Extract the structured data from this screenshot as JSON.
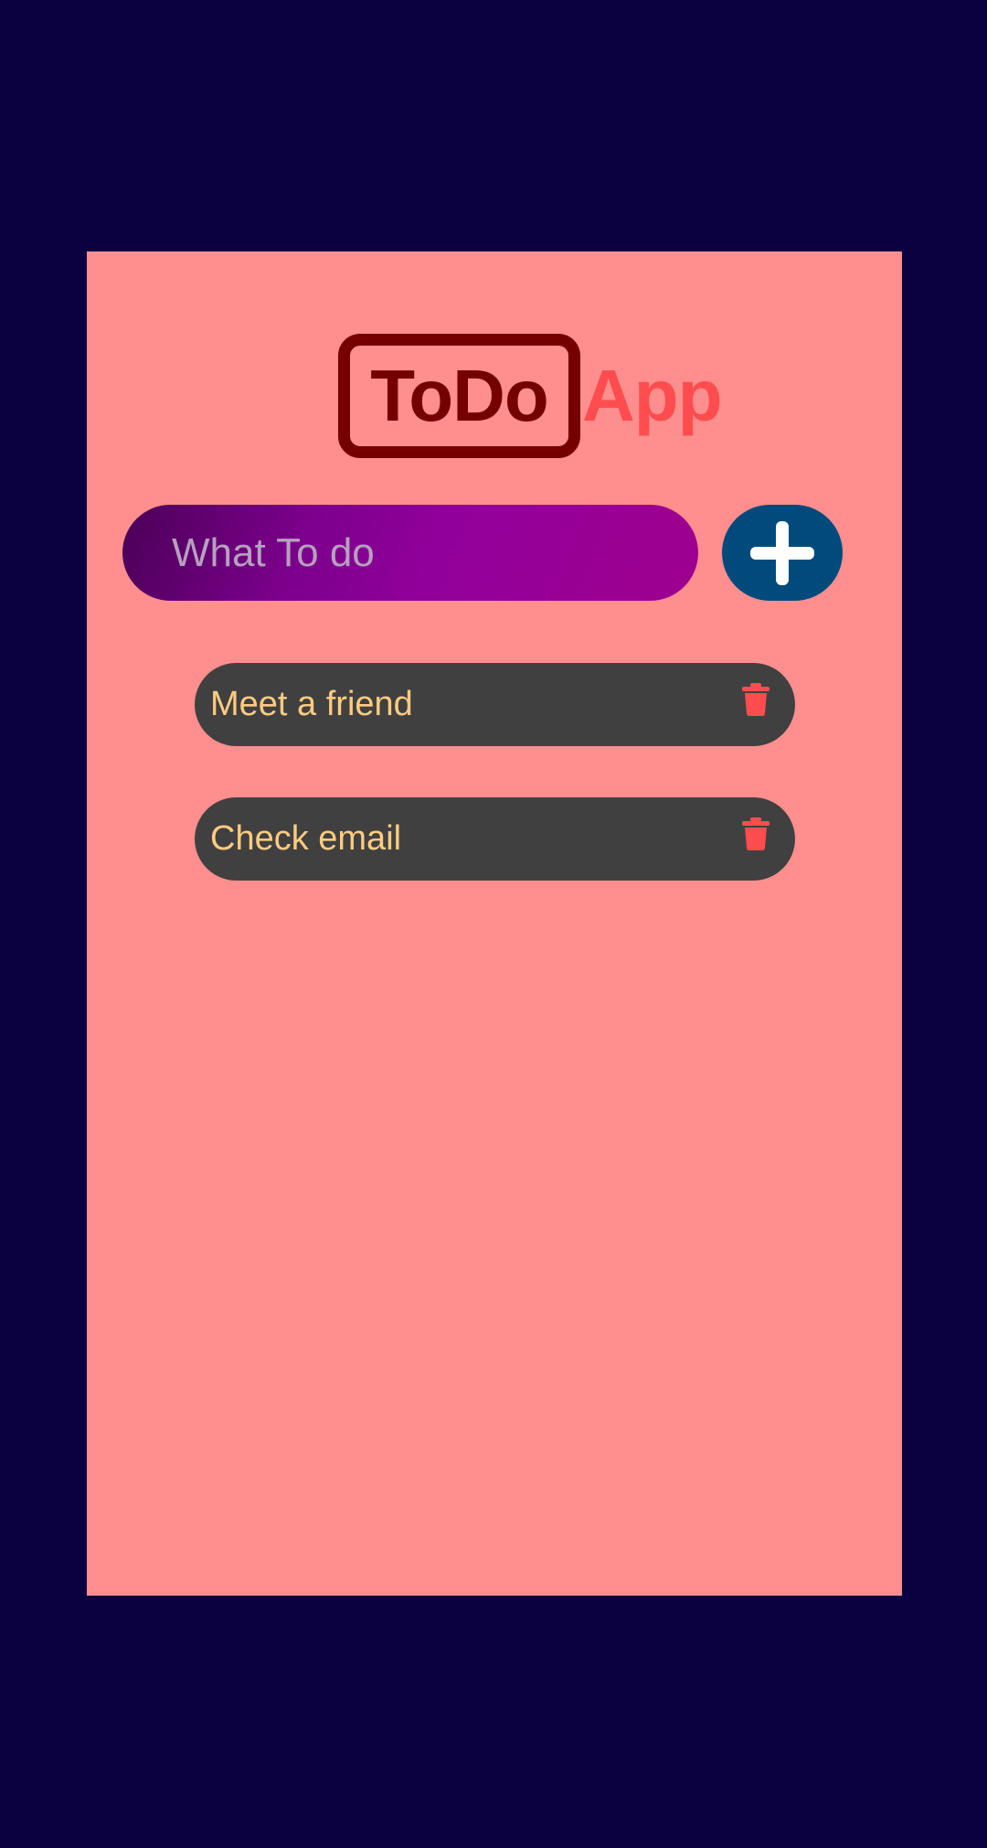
{
  "app": {
    "title_boxed": "ToDo",
    "title_accent": "App"
  },
  "input": {
    "value": "",
    "placeholder": "What To do"
  },
  "add_button": {
    "icon": "plus-icon"
  },
  "todos": [
    {
      "text": "Meet a friend",
      "delete_icon": "trash-icon"
    },
    {
      "text": "Check email",
      "delete_icon": "trash-icon"
    }
  ],
  "colors": {
    "page_background": "#0b0040",
    "card_background": "#ff8f8e",
    "title_dark": "#750000",
    "title_accent": "#ff4d4f",
    "add_button": "#004a7c",
    "todo_item_bg": "#404040",
    "todo_text": "#ffcc80",
    "delete_icon": "#ff4d4f"
  }
}
